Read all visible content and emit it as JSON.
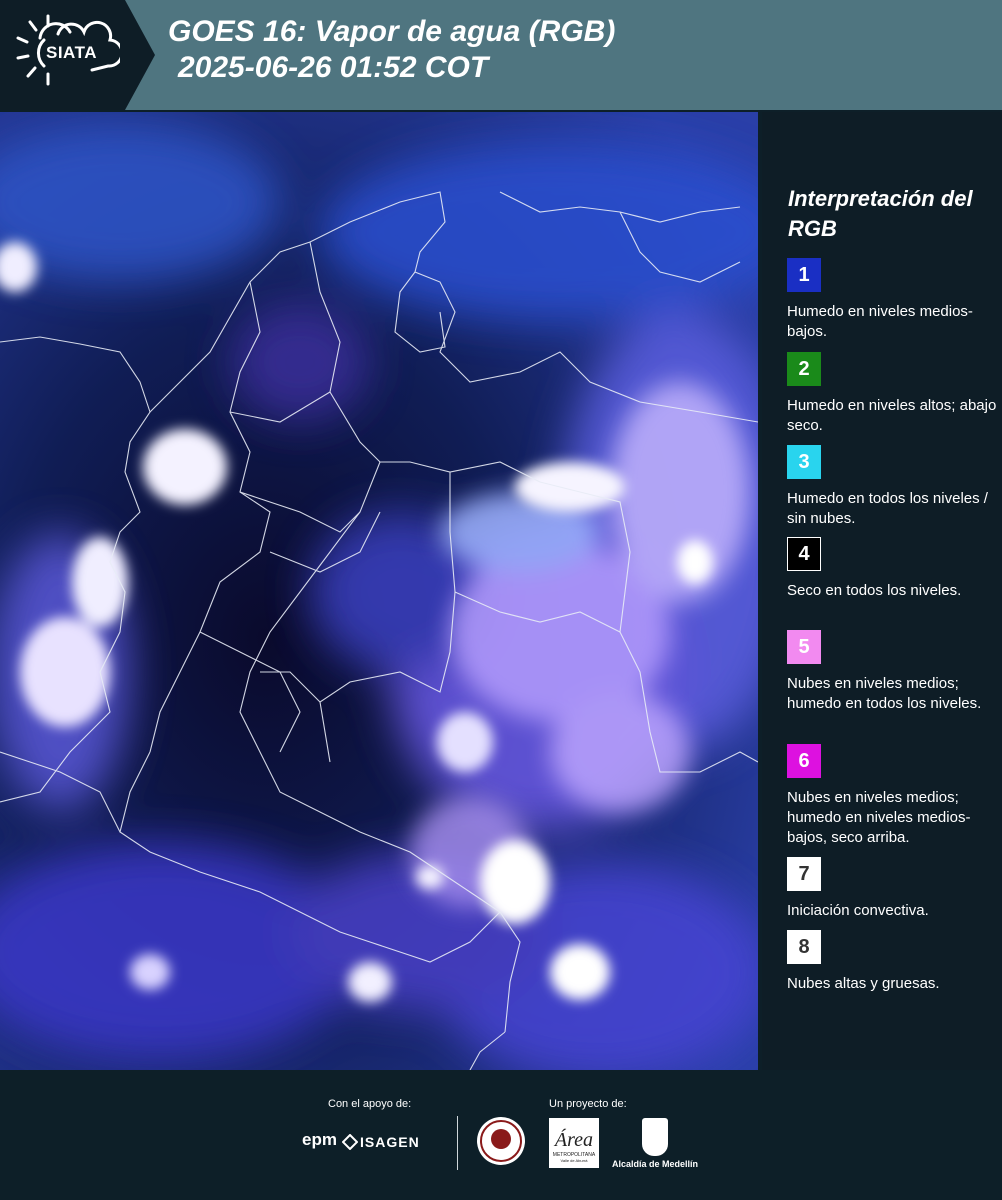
{
  "header": {
    "logo_text": "SIATA",
    "title_line1": "GOES 16: Vapor de agua (RGB)",
    "title_line2": "2025-06-26 01:52 COT"
  },
  "legend": {
    "title": "Interpretación del RGB",
    "items": [
      {
        "num": "1",
        "color": "#1a2fc4",
        "desc": "Humedo en niveles medios-bajos."
      },
      {
        "num": "2",
        "color": "#1a8a1a",
        "desc": "Humedo en niveles altos; abajo seco."
      },
      {
        "num": "3",
        "color": "#29d4ee",
        "desc": "Humedo en todos los niveles / sin nubes."
      },
      {
        "num": "4",
        "color": "#000000",
        "desc": "Seco en todos los niveles."
      },
      {
        "num": "5",
        "color": "#f28af0",
        "desc": "Nubes en niveles medios; humedo en todos los niveles."
      },
      {
        "num": "6",
        "color": "#dd11e0",
        "desc": "Nubes en niveles medios; humedo en niveles medios-bajos, seco arriba."
      },
      {
        "num": "7",
        "color": "#ffffff",
        "desc": "Iniciación convectiva."
      },
      {
        "num": "8",
        "color": "#ffffff",
        "desc": "Nubes altas y gruesas."
      }
    ]
  },
  "footer": {
    "support_label": "Con el apoyo de:",
    "project_label": "Un proyecto de:",
    "sponsor_1": "epm",
    "sponsor_2": "ISAGEN",
    "partner_1_lines": [
      "METROPOLITANA",
      "Valle de Aburrá"
    ],
    "partner_2": "Alcaldía de Medellín"
  }
}
